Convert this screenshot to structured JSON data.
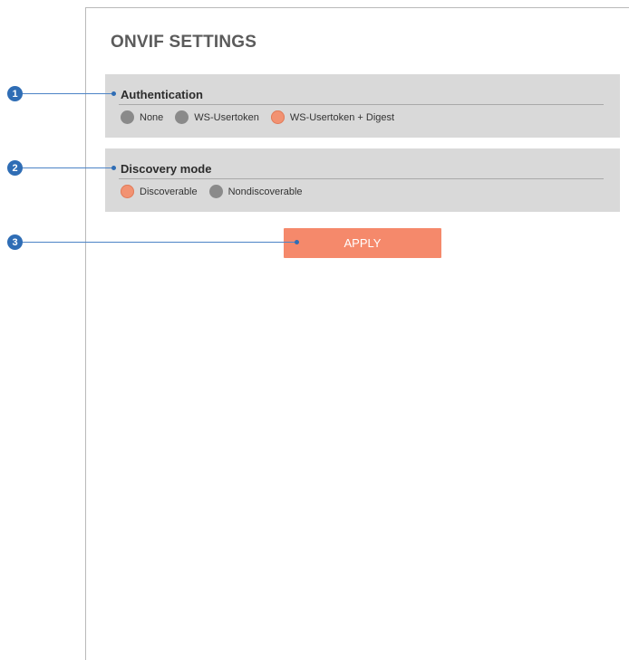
{
  "page": {
    "title": "ONVIF SETTINGS"
  },
  "authentication": {
    "label": "Authentication",
    "options": [
      {
        "label": "None",
        "selected": false
      },
      {
        "label": "WS-Usertoken",
        "selected": false
      },
      {
        "label": "WS-Usertoken + Digest",
        "selected": true
      }
    ]
  },
  "discovery": {
    "label": "Discovery mode",
    "options": [
      {
        "label": "Discoverable",
        "selected": true
      },
      {
        "label": "Nondiscoverable",
        "selected": false
      }
    ]
  },
  "apply_button": {
    "label": "APPLY"
  },
  "callouts": [
    "1",
    "2",
    "3"
  ],
  "colors": {
    "accent": "#f5896b",
    "radio_selected": "#f29272",
    "radio_unselected": "#8a8a8a",
    "panel": "#d9d9d9",
    "callout": "#2f6db5"
  }
}
